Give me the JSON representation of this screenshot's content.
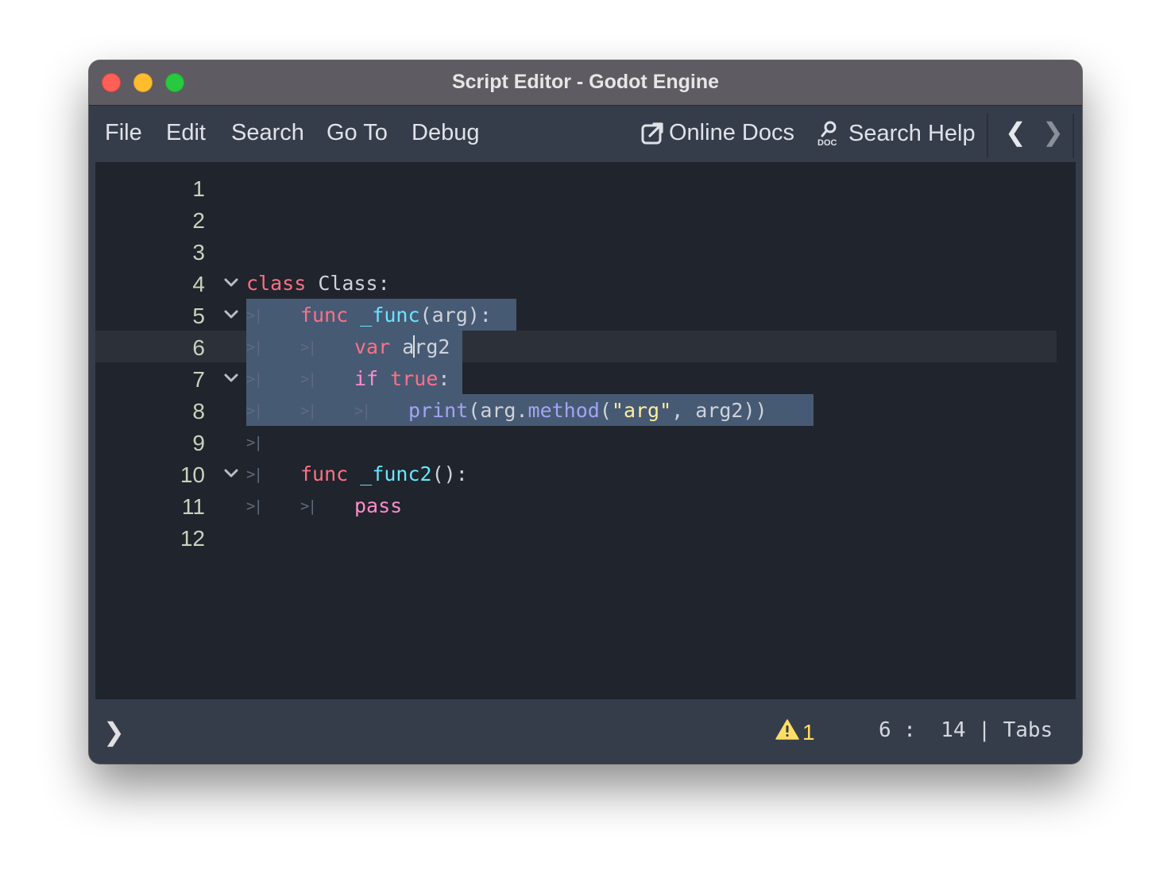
{
  "window": {
    "title": "Script Editor - Godot Engine"
  },
  "menu": {
    "items": [
      "File",
      "Edit",
      "Search",
      "Go To",
      "Debug"
    ],
    "online_docs": "Online Docs",
    "search_help": "Search Help"
  },
  "editor": {
    "line_numbers": [
      "1",
      "2",
      "3",
      "4",
      "5",
      "6",
      "7",
      "8",
      "9",
      "10",
      "11",
      "12"
    ],
    "current_line": 6
  },
  "status": {
    "warning_count": "1",
    "line": "6",
    "column": "14",
    "indent_mode": "Tabs"
  },
  "colors": {
    "keyword": "#ff7085",
    "control_keyword": "#ff8ccc",
    "function": "#66e6ff",
    "method": "#a3a3f5",
    "string": "#ffeda1",
    "selection": "#475a74",
    "warning": "#ffdd65"
  }
}
